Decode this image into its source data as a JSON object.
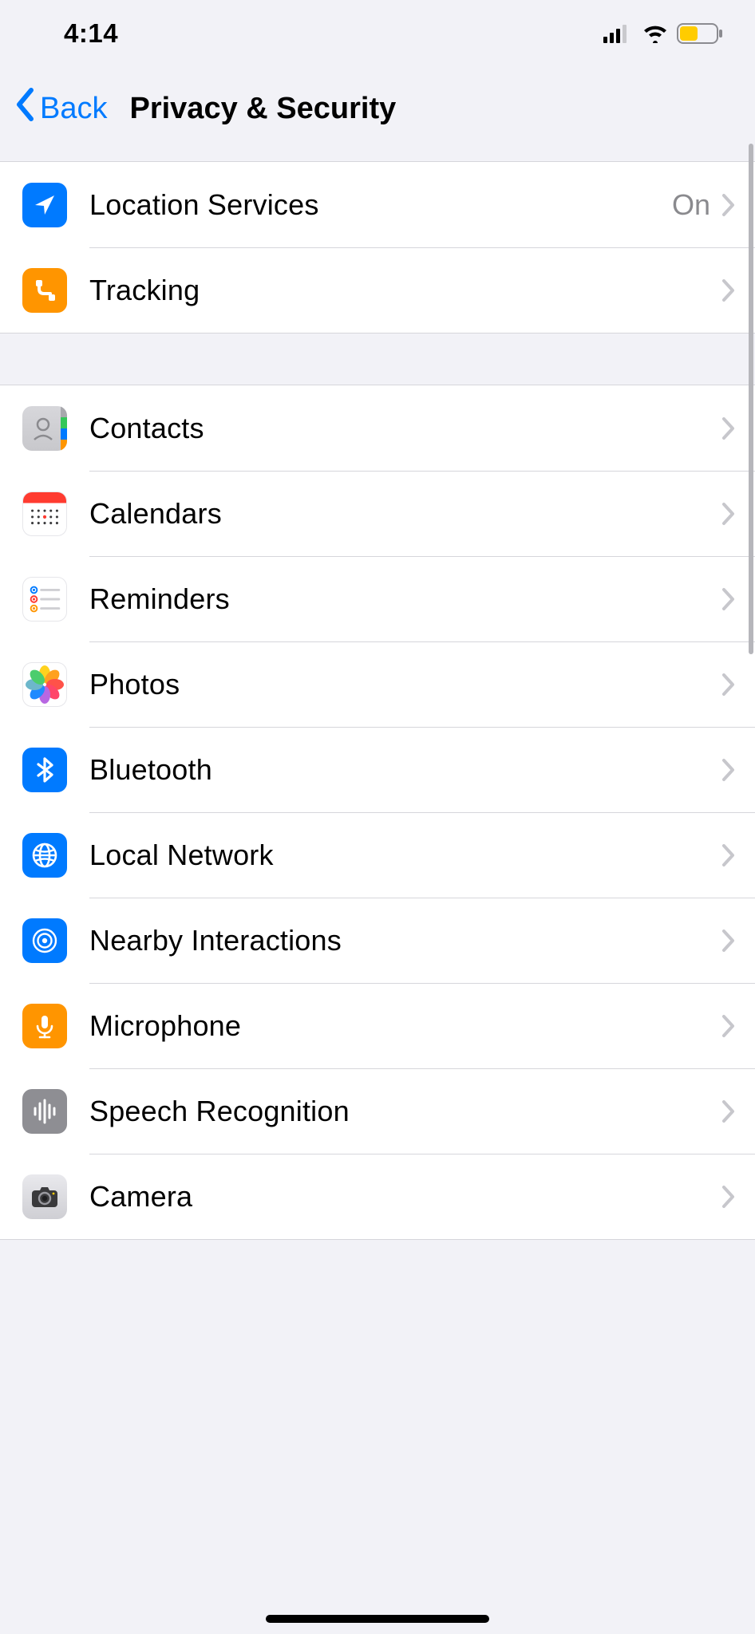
{
  "status": {
    "time": "4:14"
  },
  "nav": {
    "back": "Back",
    "title": "Privacy & Security"
  },
  "groups": [
    {
      "rows": [
        {
          "id": "location-services",
          "label": "Location Services",
          "value": "On"
        },
        {
          "id": "tracking",
          "label": "Tracking"
        }
      ]
    },
    {
      "rows": [
        {
          "id": "contacts",
          "label": "Contacts"
        },
        {
          "id": "calendars",
          "label": "Calendars"
        },
        {
          "id": "reminders",
          "label": "Reminders"
        },
        {
          "id": "photos",
          "label": "Photos"
        },
        {
          "id": "bluetooth",
          "label": "Bluetooth"
        },
        {
          "id": "local-network",
          "label": "Local Network"
        },
        {
          "id": "nearby-interactions",
          "label": "Nearby Interactions"
        },
        {
          "id": "microphone",
          "label": "Microphone"
        },
        {
          "id": "speech-recognition",
          "label": "Speech Recognition"
        },
        {
          "id": "camera",
          "label": "Camera"
        }
      ]
    }
  ]
}
